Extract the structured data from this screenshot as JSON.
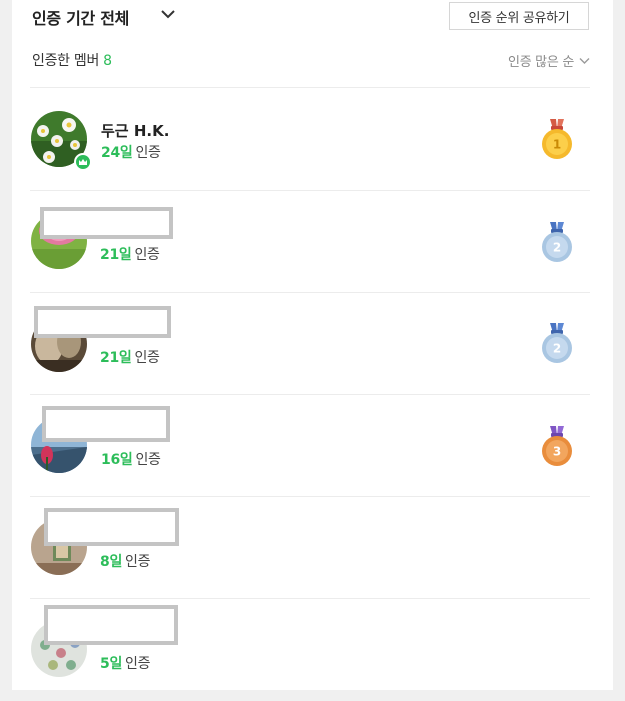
{
  "header": {
    "period_label": "인증 기간 전체",
    "share_label": "인증 순위 공유하기"
  },
  "members": {
    "label": "인증한 멤버",
    "count": "8",
    "sort_label": "인증 많은 순"
  },
  "list": [
    {
      "name": "두근 H.K.",
      "days": "24일",
      "suffix": "인증",
      "rank": "1",
      "leader": true
    },
    {
      "name": "",
      "days": "21일",
      "suffix": "인증",
      "rank": "2"
    },
    {
      "name": "",
      "days": "21일",
      "suffix": "인증",
      "rank": "2"
    },
    {
      "name": "",
      "days": "16일",
      "suffix": "인증",
      "rank": "3"
    },
    {
      "name": "",
      "days": "8일",
      "suffix": "인증"
    },
    {
      "name": "",
      "days": "5일",
      "suffix": "인증"
    }
  ],
  "colors": {
    "accent_green": "#2dbd5a",
    "gold": "#f5b92c",
    "silver": "#a9c6e2",
    "bronze": "#e98d3c",
    "redaction_border": "#c4c4c4"
  },
  "icons": {
    "period_dropdown": "chevron-down-icon",
    "sort_dropdown": "chevron-down-icon",
    "leader": "crown-icon",
    "rank": "medal-icon"
  }
}
